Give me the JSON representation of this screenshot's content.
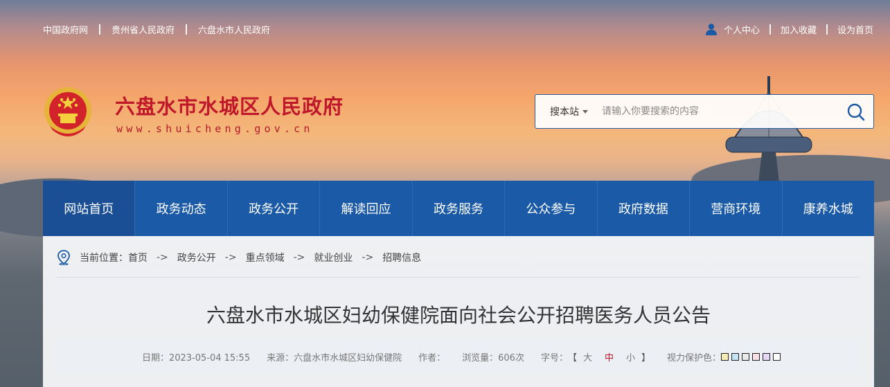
{
  "top_links": [
    "中国政府网",
    "贵州省人民政府",
    "六盘水市人民政府"
  ],
  "top_right": {
    "user": "个人中心",
    "favorite": "加入收藏",
    "homepage": "设为首页"
  },
  "site": {
    "title": "六盘水市水城区人民政府",
    "url": "www.shuicheng.gov.cn"
  },
  "search": {
    "scope": "搜本站",
    "placeholder": "请输入你要搜索的内容"
  },
  "nav": [
    "网站首页",
    "政务动态",
    "政务公开",
    "解读回应",
    "政务服务",
    "公众参与",
    "政府数据",
    "营商环境",
    "康养水城"
  ],
  "breadcrumb": {
    "label": "当前位置：",
    "items": [
      "首页",
      "政务公开",
      "重点领域",
      "就业创业",
      "招聘信息"
    ],
    "sep": "->"
  },
  "article": {
    "title": "六盘水市水城区妇幼保健院面向社会公开招聘医务人员公告",
    "date": "日期：2023-05-04 15:55",
    "source": "来源：六盘水市水城区妇幼保健院",
    "author": "作者：",
    "views": "浏览量：606次",
    "font_label": "字号：",
    "font_sizes": [
      "大",
      "中",
      "小"
    ],
    "eye_label": "视力保护色："
  },
  "eye_colors": [
    "#f7ecb3",
    "#c5e3f3",
    "#e9e9e9",
    "#f8e0e6",
    "#e8d6f5",
    "#ffffff"
  ],
  "colors": {
    "nav_bg": "#1b5aa6",
    "title_red": "#c0182b"
  }
}
